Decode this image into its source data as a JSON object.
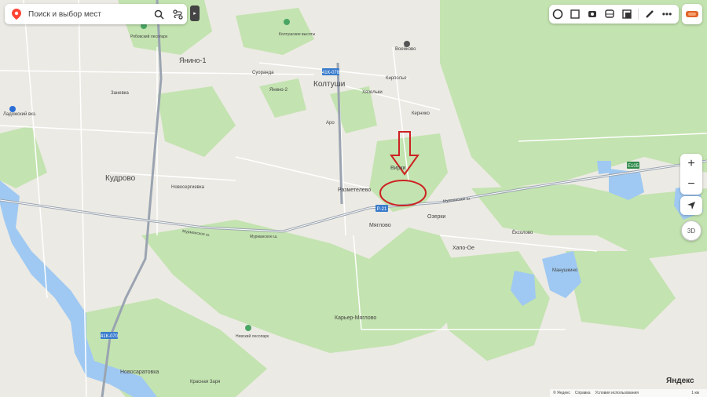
{
  "search": {
    "placeholder": "Поиск и выбор мест"
  },
  "places": {
    "yanino1": "Янино-1",
    "kudrovo": "Кудрово",
    "koltushi": "Колтуши",
    "razmetelevo": "Разметелево",
    "myaglovo": "Мяглово",
    "ozerki": "Озерки",
    "vira": "Вирки",
    "keriko": "Кернико",
    "kirpolye": "Кирполье",
    "khirelki": "Хязельки",
    "voeikovo": "Воейково",
    "suoranda": "Суоранда",
    "yanino2": "Янино-2",
    "zanevka": "Заневка",
    "novosergievka": "Новосергиевка",
    "hapoe": "Хапо-Ое",
    "ekolovo": "Ёксолово",
    "manushkino": "Манушкино",
    "karyer": "Карьер-Мяглово",
    "novosaratovka": "Новосаратовка",
    "krasnaya_zarya": "Красная Заря",
    "aro": "Аро",
    "koltush_vysoty": "Колтушские высоты",
    "ryabovsky_park": "Рябовский лесопарк",
    "nevsky_park": "Невский лесопарк",
    "ladozhsky": "Ладожский вкз."
  },
  "roads": {
    "murmansk1": "Мурманское ш.",
    "murmansk2": "Мурманское ш.",
    "murmansk3": "Мурманское ш.",
    "r21_a": "Р-21",
    "r21_b": "Р-21",
    "r41k078": "41К-078",
    "r41k070": "41К-070",
    "e105": "E105"
  },
  "controls": {
    "zoom_in": "+",
    "zoom_out": "−",
    "btn_3d": "3D"
  },
  "branding": {
    "logo": "Яндекс"
  },
  "footer": {
    "copyright": "© Яндекс",
    "help": "Справка",
    "terms": "Условия использования",
    "scale": "1 км"
  },
  "colors": {
    "water": "#9fc9f2",
    "forest": "#c3e3b0",
    "road_main": "#9aa4b1",
    "annotation": "#cc2222"
  },
  "icons": [
    "map-pin-icon",
    "search-icon",
    "route-icon",
    "layers-icon",
    "traffic-icon",
    "transport-icon",
    "ruler-icon",
    "more-icon",
    "locate-icon"
  ]
}
